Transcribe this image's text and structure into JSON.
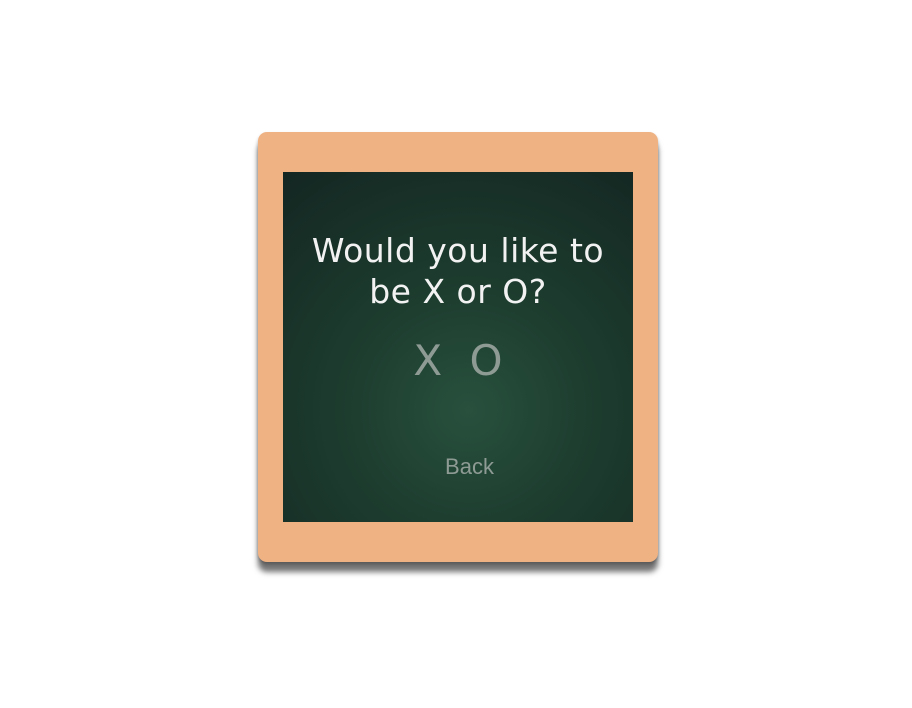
{
  "dialog": {
    "question_line1": "Would you like to",
    "question_line2": "be X or O?",
    "choice_x": "X",
    "choice_o": "O",
    "back_label": "Back"
  },
  "colors": {
    "frame": "#efb283",
    "board": "#1d3d2f",
    "text": "#f2f2f2",
    "muted": "#8e9b95"
  }
}
